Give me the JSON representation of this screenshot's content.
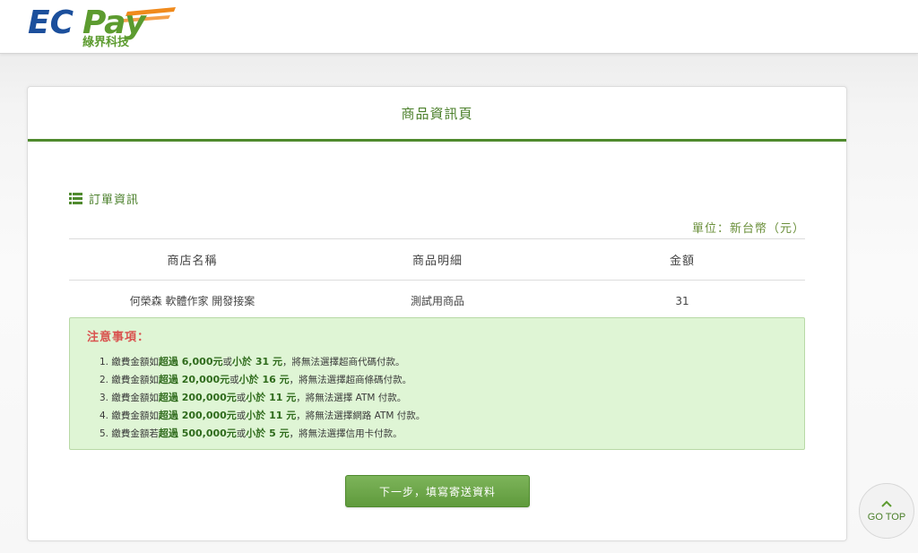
{
  "header": {
    "logo_text": "ECPay",
    "logo_subtitle": "綠界科技"
  },
  "card": {
    "title": "商品資訊頁",
    "section_label": "訂單資訊",
    "unit_label": "單位：新台幣（元）",
    "table": {
      "headers": [
        "商店名稱",
        "商品明細",
        "金額"
      ],
      "rows": [
        [
          "何榮森 軟體作家 開發接案",
          "測試用商品",
          "31"
        ]
      ]
    },
    "notice": {
      "title": "注意事項：",
      "items": [
        {
          "prefix": "1. 繳費金額如",
          "over": "超過 6,000元",
          "mid": "或",
          "under": "小於 31 元",
          "suffix": "，將無法選擇超商代碼付款。"
        },
        {
          "prefix": "2. 繳費金額如",
          "over": "超過 20,000元",
          "mid": "或",
          "under": "小於 16 元",
          "suffix": "，將無法選擇超商條碼付款。"
        },
        {
          "prefix": "3. 繳費金額如",
          "over": "超過 200,000元",
          "mid": "或",
          "under": "小於 11 元",
          "suffix": "，將無法選擇 ATM 付款。"
        },
        {
          "prefix": "4. 繳費金額如",
          "over": "超過 200,000元",
          "mid": "或",
          "under": "小於 11 元",
          "suffix": "，將無法選擇網路 ATM 付款。"
        },
        {
          "prefix": "5. 繳費金額若",
          "over": "超過 500,000元",
          "mid": "或",
          "under": "小於 5 元",
          "suffix": "，將無法選擇信用卡付款。"
        }
      ]
    },
    "next_button_label": "下一步，填寫寄送資料"
  },
  "gotop": {
    "label": "GO TOP"
  },
  "icons": {
    "section": "list-icon",
    "gotop": "chevron-up-icon"
  },
  "colors": {
    "brand_blue": "#1b4f9c",
    "brand_green": "#5c9b2f",
    "brand_orange": "#f08a1c",
    "accent_green": "#4f8a2e",
    "notice_bg": "#dff5d5",
    "notice_title": "#d9534f"
  }
}
